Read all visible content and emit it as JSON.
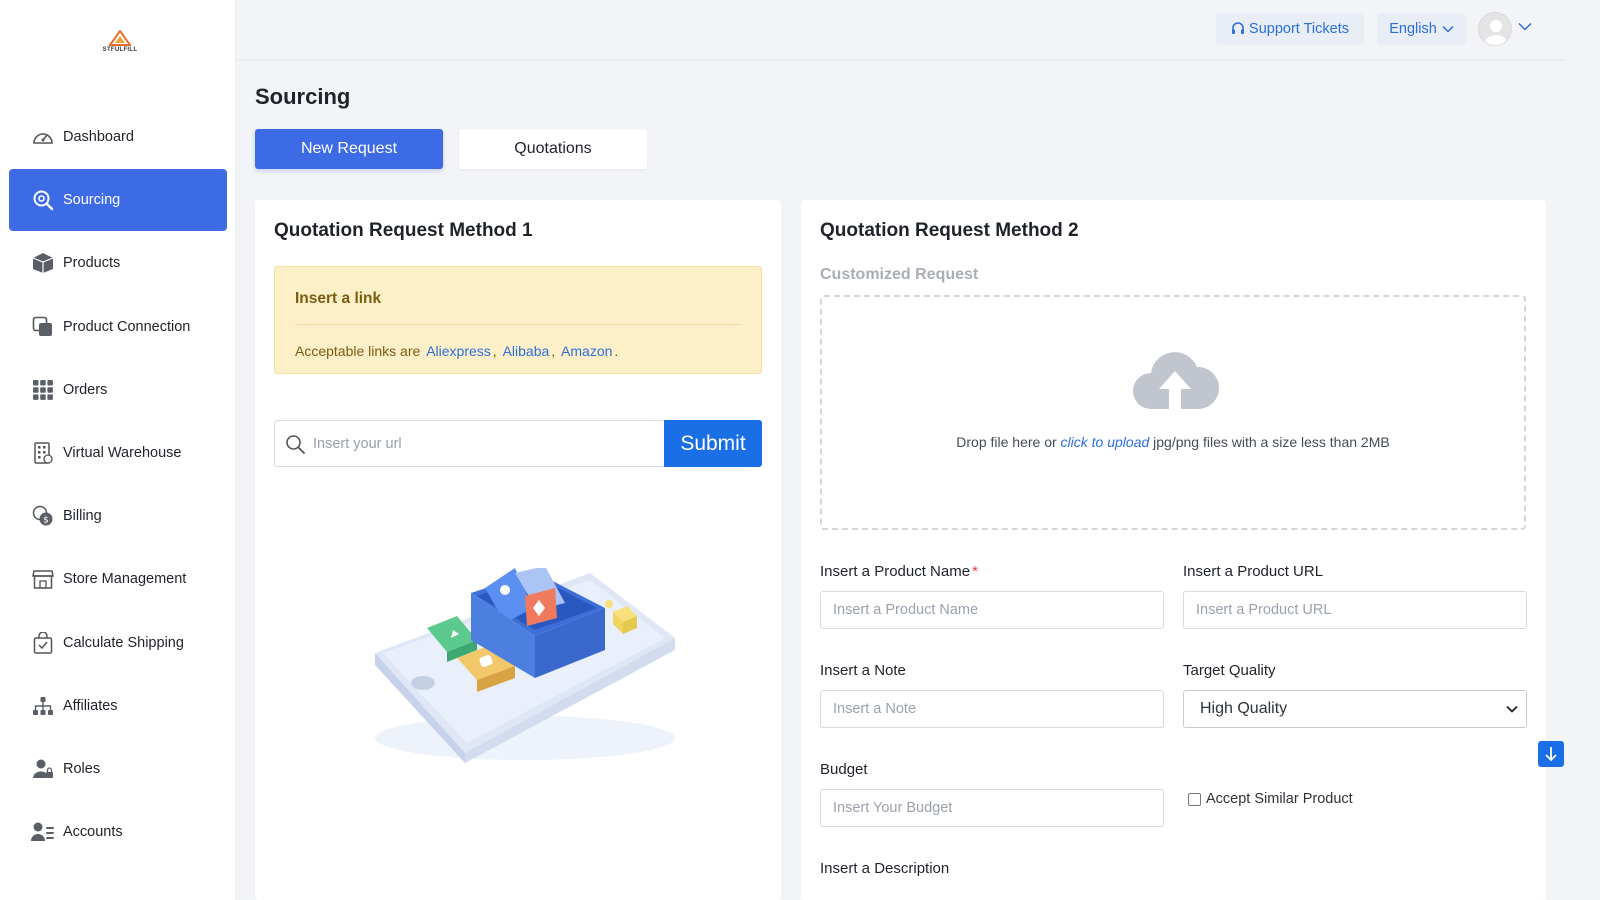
{
  "brand": {
    "logo_text": "STFULFILL"
  },
  "sidebar": {
    "items": [
      {
        "label": "Dashboard",
        "icon": "dashboard-gauge-icon"
      },
      {
        "label": "Sourcing",
        "icon": "search-icon",
        "active": true
      },
      {
        "label": "Products",
        "icon": "box-icon"
      },
      {
        "label": "Product Connection",
        "icon": "link-squares-icon"
      },
      {
        "label": "Orders",
        "icon": "grid-icon"
      },
      {
        "label": "Virtual Warehouse",
        "icon": "building-icon"
      },
      {
        "label": "Billing",
        "icon": "coins-icon"
      },
      {
        "label": "Store Management",
        "icon": "store-icon"
      },
      {
        "label": "Calculate Shipping",
        "icon": "shopping-bag-icon"
      },
      {
        "label": "Affiliates",
        "icon": "network-icon"
      },
      {
        "label": "Roles",
        "icon": "user-lock-icon"
      },
      {
        "label": "Accounts",
        "icon": "user-list-icon"
      }
    ]
  },
  "header": {
    "support_label": "Support Tickets",
    "language_label": "English"
  },
  "page": {
    "title": "Sourcing",
    "tabs": [
      "New Request",
      "Quotations"
    ]
  },
  "method1": {
    "title": "Quotation Request Method 1",
    "alert_title": "Insert a link",
    "alert_prefix": "Acceptable links are",
    "links": [
      "Aliexpress",
      "Alibaba",
      "Amazon"
    ],
    "alert_suffix": ".",
    "url_placeholder": "Insert your url",
    "submit_label": "Submit"
  },
  "method2": {
    "title": "Quotation Request Method 2",
    "subtitle": "Customized Request",
    "drop_prefix": "Drop file here or",
    "drop_link": "click to upload",
    "drop_suffix": "jpg/png files with a size less than 2MB",
    "fields": {
      "product_name_label": "Insert a Product Name",
      "product_name_placeholder": "Insert a Product Name",
      "product_url_label": "Insert a Product URL",
      "product_url_placeholder": "Insert a Product URL",
      "note_label": "Insert a Note",
      "note_placeholder": "Insert a Note",
      "quality_label": "Target Quality",
      "quality_value": "High Quality",
      "budget_label": "Budget",
      "budget_placeholder": "Insert Your Budget",
      "similar_label": "Accept Similar Product",
      "description_label": "Insert a Description"
    }
  },
  "colors": {
    "primary": "#3d6be6",
    "submit": "#1b6fe6",
    "alert_bg": "#fdf0c8",
    "link": "#2b6fdc"
  }
}
